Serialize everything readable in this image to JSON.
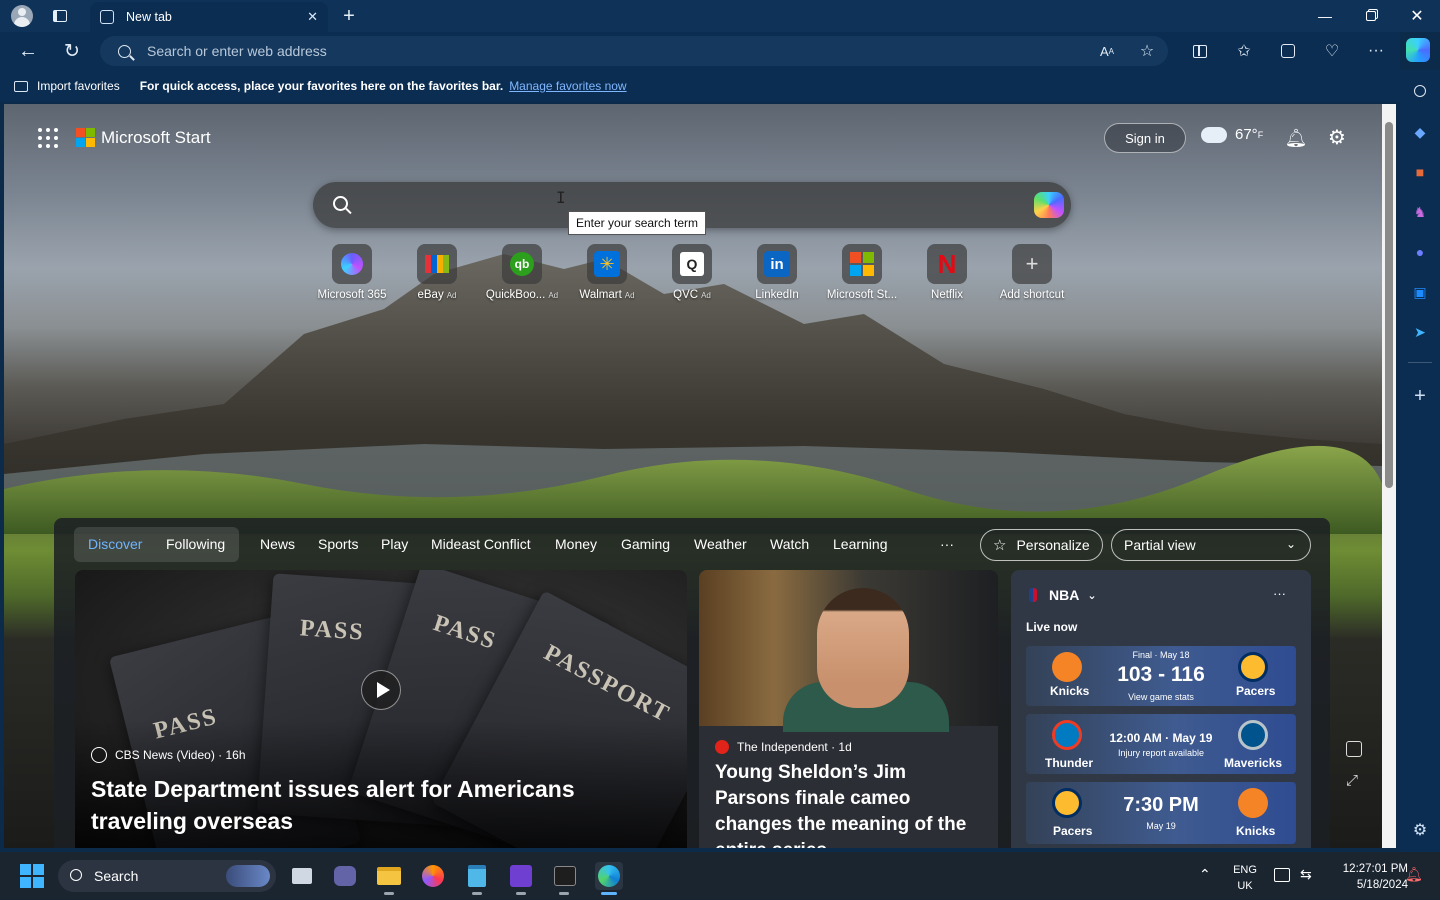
{
  "browser": {
    "tab_title": "New tab",
    "address_placeholder": "Search or enter web address"
  },
  "favorites_bar": {
    "import_label": "Import favorites",
    "message": "For quick access, place your favorites here on the favorites bar.",
    "manage_link": "Manage favorites now"
  },
  "start": {
    "brand": "Microsoft Start",
    "sign_in": "Sign in",
    "temperature": "67°",
    "temp_unit": "F",
    "search_tooltip": "Enter your search term"
  },
  "shortcuts": [
    {
      "label": "Microsoft 365",
      "ad": "",
      "icon": "m365-icon",
      "color": "#6b5cff"
    },
    {
      "label": "eBay",
      "ad": "Ad",
      "icon": "ebay-icon",
      "color": "#e53238"
    },
    {
      "label": "QuickBoo...",
      "ad": "Ad",
      "icon": "quickbooks-icon",
      "color": "#2ca01c"
    },
    {
      "label": "Walmart",
      "ad": "Ad",
      "icon": "walmart-icon",
      "color": "#0071dc"
    },
    {
      "label": "QVC",
      "ad": "Ad",
      "icon": "qvc-icon",
      "color": "#ffffff"
    },
    {
      "label": "LinkedIn",
      "ad": "",
      "icon": "linkedin-icon",
      "color": "#0a66c2"
    },
    {
      "label": "Microsoft St...",
      "ad": "",
      "icon": "microsoft-store-icon",
      "color": "#f25022"
    },
    {
      "label": "Netflix",
      "ad": "",
      "icon": "netflix-icon",
      "color": "#e50914"
    },
    {
      "label": "Add shortcut",
      "ad": "",
      "icon": "plus-icon",
      "color": "#dddddd"
    }
  ],
  "feed_nav": {
    "items": [
      "Discover",
      "Following",
      "News",
      "Sports",
      "Play",
      "Mideast Conflict",
      "Money",
      "Gaming",
      "Weather",
      "Watch",
      "Learning"
    ],
    "more": "···",
    "personalize": "Personalize",
    "view": "Partial view"
  },
  "cards": {
    "main": {
      "source": "CBS News (Video) · 16h",
      "headline": "State Department issues alert for Americans traveling overseas",
      "image_text": [
        "PASS",
        "PASS",
        "PASSPORT",
        "PASS"
      ]
    },
    "second": {
      "source": "The Independent · 1d",
      "headline": "Young Sheldon’s Jim Parsons finale cameo changes the meaning of the entire series"
    },
    "nba": {
      "title": "NBA",
      "live_label": "Live now",
      "menu": "···",
      "games": [
        {
          "status": "Final · May 18",
          "score": "103 - 116",
          "sub": "View game stats",
          "home": "Knicks",
          "away": "Pacers",
          "home_color": "#f58426",
          "away_color": "#fdbb30"
        },
        {
          "status": "",
          "score": "12:00 AM · May 19",
          "sub": "Injury report available",
          "home": "Thunder",
          "away": "Mavericks",
          "home_color": "#ef3b24",
          "away_color": "#00538c"
        },
        {
          "status": "",
          "score": "7:30 PM",
          "sub": "May 19",
          "home": "Pacers",
          "away": "Knicks",
          "home_color": "#fdbb30",
          "away_color": "#f58426"
        }
      ]
    }
  },
  "taskbar": {
    "search_label": "Search",
    "lang": "ENG",
    "region": "UK",
    "time": "12:27:01 PM",
    "date": "5/18/2024"
  }
}
